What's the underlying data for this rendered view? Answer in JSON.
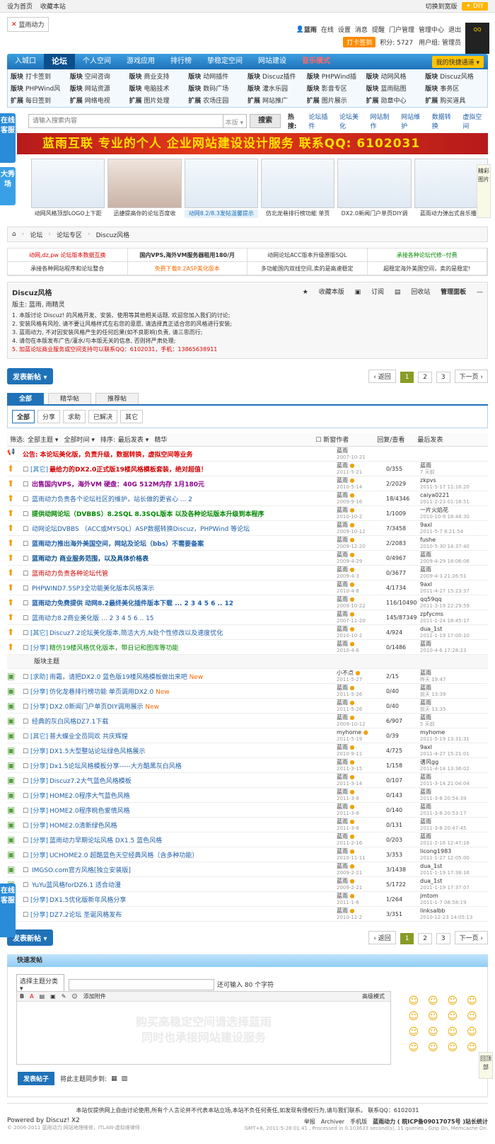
{
  "topbar": {
    "set_home": "设为首页",
    "favorite": "收藏本站",
    "switch_width": "切换到宽版",
    "diy": "DIY"
  },
  "header": {
    "logo_text": "蓝雨动力",
    "username": "蓝雨",
    "status": "在线",
    "links": [
      "设置",
      "消息",
      "提醒",
      "门户管理",
      "管理中心",
      "退出"
    ],
    "punch": "打卡签到",
    "score": "积分: 5727",
    "group": "用户组: 管理员",
    "qq_badge": "QQ"
  },
  "nav": {
    "items": [
      "入城口",
      "论坛",
      "个人空间",
      "游戏应用",
      "排行榜",
      "挚稳定空间",
      "网站建设",
      "音乐模式"
    ],
    "quick": "我的快捷通道"
  },
  "subnav": [
    {
      "b": "版块",
      "t": "打卡签到"
    },
    {
      "b": "版块",
      "t": "空间咨询"
    },
    {
      "b": "版块",
      "t": "商业支持"
    },
    {
      "b": "版块",
      "t": "动网插件"
    },
    {
      "b": "版块",
      "t": "Discuz插件"
    },
    {
      "b": "版块",
      "t": "PHPWind插"
    },
    {
      "b": "版块",
      "t": "动网风格"
    },
    {
      "b": "版块",
      "t": "Discuz风格"
    },
    {
      "b": "版块",
      "t": "PHPWind风"
    },
    {
      "b": "版块",
      "t": "网站资源"
    },
    {
      "b": "版块",
      "t": "电脑技术"
    },
    {
      "b": "版块",
      "t": "数码广场"
    },
    {
      "b": "版块",
      "t": "灌水乐园"
    },
    {
      "b": "版块",
      "t": "影音专区"
    },
    {
      "b": "版块",
      "t": "蓝雨贴图"
    },
    {
      "b": "版块",
      "t": "事务区"
    },
    {
      "b": "扩展",
      "t": "每日签到"
    },
    {
      "b": "扩展",
      "t": "网络电视"
    },
    {
      "b": "扩展",
      "t": "图片处理"
    },
    {
      "b": "扩展",
      "t": "农场庄园"
    },
    {
      "b": "扩展",
      "t": "网站推广"
    },
    {
      "b": "扩展",
      "t": "图片展示"
    },
    {
      "b": "扩展",
      "t": "勋章中心"
    },
    {
      "b": "扩展",
      "t": "购买道具"
    }
  ],
  "search": {
    "placeholder": "请输入搜索内容",
    "scope": "本版",
    "button": "搜索",
    "hot_label": "热搜:",
    "hot": [
      "论坛插件",
      "论坛美化",
      "网站制作",
      "网站维护",
      "数据转换",
      "虚拟空间"
    ]
  },
  "banner": "蓝雨互联   专业的个人 企业网站建设设计服务 联系QQ: 6102031",
  "side_tabs": {
    "online_service": "在线客服",
    "showcase": "大秀场",
    "hot_pics": "精彩图片"
  },
  "thumbs": [
    "动网风格顶部LOGO上下距",
    "迅捷提高你的论坛百度收",
    "动网8.2/8.3发帖温馨提示",
    "仿北龙巷排行榜功能 单页",
    "DX2.0新闻门户单页DIY调",
    "蓝雨动力弹出式音乐播放"
  ],
  "breadcrumb": [
    "论坛",
    "论坛专区",
    "Discuz风格"
  ],
  "ads": [
    "动网,dz,pw 论坛版本数据互换",
    "国内VPS,海外VM服务器租用180/月",
    "动网论坛ACC版本升级原版SQL",
    "承接各种论坛代修--付费",
    "承接各种网站程序和论坛整合",
    "免费下载8.2ASP美化版本",
    "多功能国内双线空间,卖的是高速稳定",
    "超稳定海外美国空间，卖的是稳定!"
  ],
  "forum": {
    "title": "Discuz风格",
    "moderators": "版主: 蓝雨, 雨精灵",
    "tools": [
      "收藏本版",
      "订阅",
      "回收站",
      "管理面板"
    ],
    "rules": [
      "1. 本版讨论 Discuz! 的风格开发、安装、使用等其他相关话题, 欢迎您加入我们的讨论;",
      "2. 安装风格有风险, 请不要让风格样式左右您的意愿, 请选择真正适合您的风格进行安装;",
      "3. 蓝雨动力, 不对因安装风格产生的任何后果(如不良影响)负责, 请三思而行;",
      "4. 请勿在本版发布广告/灌水/与本版无关的信息, 否则将严肃处理;",
      "5. 加蓝论坛商业服务或空间支持可以联系QQ：6102031，手机：13865638911"
    ]
  },
  "pager": {
    "new_post": "发表新帖",
    "prev": "返回",
    "pages": [
      "1",
      "2",
      "3"
    ],
    "next": "下一页"
  },
  "tabs": [
    "全部",
    "精华帖",
    "推荐帖"
  ],
  "filters": [
    "全部",
    "分享",
    "求助",
    "已解决",
    "其它"
  ],
  "list_header": {
    "filter": "筛选:",
    "all_topics": "全部主题",
    "all_time": "全部时间",
    "sort": "排序:",
    "latest": "最后发表",
    "digest": "精华",
    "new_window": "新窗作者",
    "reply_view": "回复/查看",
    "last_post": "最后发表"
  },
  "announcement": {
    "label": "公告:",
    "text": "本论坛美化版，负责升级，数据转换，虚拟空间等业务",
    "author": "蓝雨",
    "date": "2007-10-21"
  },
  "pinned": [
    {
      "cat": "[其它]",
      "title": "最给力的DX2.0正式版19楼风格模板套装，绝对超值！",
      "author": "蓝雨",
      "adate": "2011-5-21",
      "rv": "0/355",
      "last": "蓝雨",
      "ldate": "7 天前",
      "color": "#d00000",
      "bold": true
    },
    {
      "cat": "",
      "title": "出售国内VPS，海外VM 硬盘：40G 512M内存 1月180元",
      "author": "蓝雨",
      "adate": "2010-5-14",
      "rv": "2/2029",
      "last": "zkpvs",
      "ldate": "2011-5-17 11:16:20",
      "color": "#8b008b",
      "bold": true
    },
    {
      "cat": "",
      "title": "蓝雨动力负责各个论坛社区的维护，站长做的更省心 ... 2",
      "author": "蓝雨",
      "adate": "2009-9-16",
      "rv": "18/4346",
      "last": "caiya0221",
      "ldate": "2011-2-23 01:16:51",
      "color": "#1f5fa8",
      "bold": false
    },
    {
      "cat": "",
      "title": "提供动网论坛（DVBBS）8.2SQL 8.3SQL版本 以及各种论坛版本升级到本程序",
      "author": "蓝雨",
      "adate": "2010-10-2",
      "rv": "1/1009",
      "last": "一片火焰花",
      "ldate": "2010-10-9 18:48:30",
      "color": "#008800",
      "bold": true
    },
    {
      "cat": "",
      "title": "动网论坛DVBBS （ACC或MYSQL）ASP数据转换Discuz，PHPWind 等论坛",
      "author": "蓝雨",
      "adate": "2009-10-12",
      "rv": "7/3458",
      "last": "9axl",
      "ldate": "2011-5-7 8:21:54",
      "color": "#1f5fa8",
      "bold": false
    },
    {
      "cat": "",
      "title": "蓝雨动力推出海外美国空间，网站及论坛（bbs）不需要备案",
      "author": "蓝雨",
      "adate": "2009-12-20",
      "rv": "2/2083",
      "last": "fushe",
      "ldate": "2010-5-30 14:37:40",
      "color": "#1f5fa8",
      "bold": true
    },
    {
      "cat": "",
      "title": "蓝雨动力 商业服务范围，以及具体价格表",
      "author": "蓝雨",
      "adate": "2009-4-29",
      "rv": "0/4967",
      "last": "蓝雨",
      "ldate": "2009-4-29 18:06:06",
      "color": "#0a4f8c",
      "bold": true
    },
    {
      "cat": "",
      "title": "蓝雨动力负责各种论坛代管",
      "author": "蓝雨",
      "adate": "2009-4-3",
      "rv": "0/3677",
      "last": "蓝雨",
      "ldate": "2009-4-3 21:26:51",
      "color": "#d00000",
      "bold": false
    },
    {
      "cat": "",
      "title": "PHPWIND7.5SP3全功能美化版本风格演示",
      "author": "蓝雨",
      "adate": "2010-4-8",
      "rv": "4/1734",
      "last": "9axl",
      "ldate": "2011-4-27 15:23:37",
      "color": "#1f5fa8",
      "bold": false
    },
    {
      "cat": "",
      "title": "蓝雨动力免费提供 动网8.2最终美化插件版本下载 ... 2 3 4 5 6 .. 12",
      "author": "蓝雨",
      "adate": "2009-10-22",
      "rv": "116/10490",
      "last": "qq59qq",
      "ldate": "2011-3-19 22:29:59",
      "color": "#1f5fa8",
      "bold": true
    },
    {
      "cat": "",
      "title": "蓝雨动力8.2商业美化版 ... 2 3 4 5 6 .. 15",
      "author": "蓝雨",
      "adate": "2007-11-20",
      "rv": "145/87349",
      "last": "zpfycms",
      "ldate": "2011-1-24 18:45:17",
      "color": "#1f5fa8",
      "bold": false
    },
    {
      "cat": "[其它]",
      "title": "Discuz7.2论坛美化版本,简洁大方,N处个性修改以及速度优化",
      "author": "蓝雨",
      "adate": "2010-10-2",
      "rv": "4/924",
      "last": "dua_1st",
      "ldate": "2011-1-19 17:00:10",
      "color": "#1f5fa8",
      "bold": false
    },
    {
      "cat": "[分享]",
      "title": "精仿19楼风格优化版本，带日记和图库等功能",
      "author": "蓝雨",
      "adate": "2010-4-6",
      "rv": "0/1486",
      "last": "蓝雨",
      "ldate": "2010-4-6 17:28:23",
      "color": "#008800",
      "bold": false
    }
  ],
  "separator": "版块主题",
  "threads": [
    {
      "cat": "[求助]",
      "title": "雨霜，请把DX2.0 蓝色版19楼风格模板做出来吧",
      "new": "New",
      "author": "小不点",
      "adate": "2011-5-27",
      "rv": "2/15",
      "last": "蓝雨",
      "ldate": "昨天 19:47"
    },
    {
      "cat": "[分享]",
      "title": "仿化龙巷排行榜功能 单页调用DX2.0",
      "new": "New",
      "author": "蓝雨",
      "adate": "2011-5-26",
      "rv": "0/40",
      "last": "蓝雨",
      "ldate": "前天 13:39"
    },
    {
      "cat": "[分享]",
      "title": "DX2.0新闻门户单页DIY调用展示",
      "new": "New",
      "author": "蓝雨",
      "adate": "2011-5-26",
      "rv": "0/40",
      "last": "蓝雨",
      "ldate": "前天 13:35"
    },
    {
      "cat": "",
      "title": "经典的灰白风格DZ7.1下载",
      "new": "",
      "author": "蓝雨",
      "adate": "2009-10-12",
      "rv": "6/907",
      "last": "蓝雨",
      "ldate": "5 天前"
    },
    {
      "cat": "[其它]",
      "title": "普大蝶业全员同欢 共庆辉煌",
      "new": "",
      "author": "myhome",
      "adate": "2011-5-19",
      "rv": "0/39",
      "last": "myhome",
      "ldate": "2011-5-19 13:31:31"
    },
    {
      "cat": "[分享]",
      "title": "DX1.5大型整站论坛绿色风格展示",
      "new": "",
      "author": "蓝雨",
      "adate": "2010-9-11",
      "rv": "4/725",
      "last": "9axl",
      "ldate": "2011-4-27 15:21:01"
    },
    {
      "cat": "[分享]",
      "title": "Dx1.5论坛风格模板分享-----大方酷黑灰白风格",
      "new": "",
      "author": "蓝雨",
      "adate": "2011-3-15",
      "rv": "1/158",
      "last": "谱风gg",
      "ldate": "2011-4-14 13:36:02"
    },
    {
      "cat": "[分享]",
      "title": "Discuz7.2大气蓝色风格模板",
      "new": "",
      "author": "蓝雨",
      "adate": "2011-3-14",
      "rv": "0/107",
      "last": "蓝雨",
      "ldate": "2011-3-14 21:04:04"
    },
    {
      "cat": "[分享]",
      "title": "HOME2.0程序大气蓝色风格",
      "new": "",
      "author": "蓝雨",
      "adate": "2011-3-8",
      "rv": "0/143",
      "last": "蓝雨",
      "ldate": "2011-3-8 20:54:39"
    },
    {
      "cat": "[分享]",
      "title": "HOME2.0程序桃色爱情风格",
      "new": "",
      "author": "蓝雨",
      "adate": "2011-3-8",
      "rv": "0/140",
      "last": "蓝雨",
      "ldate": "2011-3-8 20:53:17"
    },
    {
      "cat": "[分享]",
      "title": "HOME2.0清新绿色风格",
      "new": "",
      "author": "蓝雨",
      "adate": "2011-3-8",
      "rv": "0/131",
      "last": "蓝雨",
      "ldate": "2011-3-8 20:47:45"
    },
    {
      "cat": "[分享]",
      "title": "蓝雨动力早期论坛风格 DX1.5 蓝色风格",
      "new": "",
      "author": "蓝雨",
      "adate": "2011-2-16",
      "rv": "0/203",
      "last": "蓝雨",
      "ldate": "2011-2-16 12:47:16"
    },
    {
      "cat": "[分享]",
      "title": "UCHOME2.0 超酷蓝色天空经典风格（含多种功能）",
      "new": "",
      "author": "蓝雨",
      "adate": "2010-11-11",
      "rv": "3/353",
      "last": "licong1983",
      "ldate": "2011-1-27 12:05:00"
    },
    {
      "cat": "",
      "title": "IMGSO.com官方风格[独立安装版]",
      "new": "",
      "author": "蓝雨",
      "adate": "2009-2-21",
      "rv": "3/1438",
      "last": "dua_1st",
      "ldate": "2011-1-19 17:38:16"
    },
    {
      "cat": "",
      "title": "YuYu蓝风格forDZ6.1 适合动漫",
      "new": "",
      "author": "蓝雨",
      "adate": "2009-2-21",
      "rv": "5/1722",
      "last": "dua_1st",
      "ldate": "2011-1-19 17:37:07"
    },
    {
      "cat": "[分享]",
      "title": "DX1.5优化版新年风格分享",
      "new": "",
      "author": "蓝雨",
      "adate": "2011-1-6",
      "rv": "1/264",
      "last": "jmtom",
      "ldate": "2011-1-7 08:58:19"
    },
    {
      "cat": "[分享]",
      "title": "DZ7.2论坛 圣诞风格发布",
      "new": "",
      "author": "蓝雨",
      "adate": "2010-12-2",
      "rv": "3/351",
      "last": "linksalbb",
      "ldate": "2010-12-23 14:05:13"
    }
  ],
  "fastpost": {
    "title": "快速发帖",
    "category": "选择主题分类",
    "remaining": "还可输入 80 个字符",
    "toolbar": [
      "B",
      "A",
      "▤",
      "▣",
      "✎",
      "☺"
    ],
    "attach": "添加附件",
    "advanced": "高级模式",
    "watermark1": "购买高稳定空间请选择蓝雨",
    "watermark2": "同时也承接网站建设服务",
    "submit": "发表帖子",
    "sync": "将此主题同步到:",
    "back_top": "回顶部"
  },
  "footer": {
    "disclaimer": "本站仅提供网上自由讨论使用,所有个人言论并不代表本站立场,本站不负任何责任,如发现有侵权行为,请与我们联系。 联系QQ：6102031",
    "powered": "Powered by Discuz! X2",
    "copyright": "© 2006-2011 蓝雨动力 网站地理维修，ITLAW-虚拟维律师",
    "links": [
      "举报",
      "Archiver",
      "手机版",
      "蓝雨动力 ( 皖ICP备09017075号 )站长统计"
    ],
    "gmt": "GMT+8, 2011-5-28 01:41 , Processed in 0.103633 second(s), 11 queries , Gzip On, Memcache On."
  }
}
